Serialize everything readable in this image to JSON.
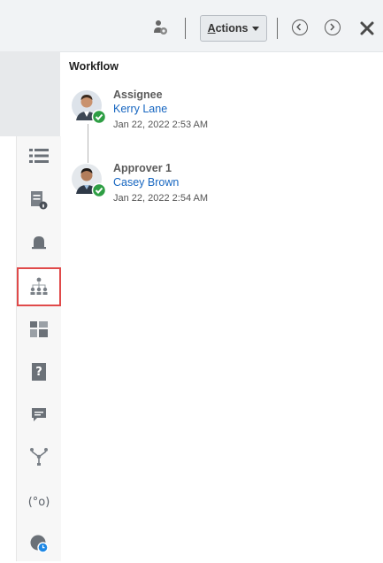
{
  "toolbar": {
    "actions_label": "Actions",
    "icons": [
      "user-config-icon",
      "chevron-left-circle-icon",
      "chevron-right-circle-icon",
      "close-icon"
    ]
  },
  "sidebar": {
    "items": [
      {
        "icon": "list-icon"
      },
      {
        "icon": "document-info-icon"
      },
      {
        "icon": "bell-icon"
      },
      {
        "icon": "workflow-hierarchy-icon",
        "selected": true
      },
      {
        "icon": "dashboard-icon"
      },
      {
        "icon": "help-icon"
      },
      {
        "icon": "comment-icon"
      },
      {
        "icon": "flow-icon"
      },
      {
        "icon": "variable-icon"
      },
      {
        "icon": "pie-clock-icon"
      }
    ]
  },
  "workflow": {
    "title": "Workflow",
    "entries": [
      {
        "role": "Assignee",
        "name": "Kerry Lane",
        "time": "Jan 22, 2022 2:53 AM"
      },
      {
        "role": "Approver 1",
        "name": "Casey Brown",
        "time": "Jan 22, 2022 2:54 AM"
      }
    ]
  },
  "colors": {
    "link": "#1565c0",
    "check": "#2e9e44",
    "highlight": "#e04a4a"
  }
}
